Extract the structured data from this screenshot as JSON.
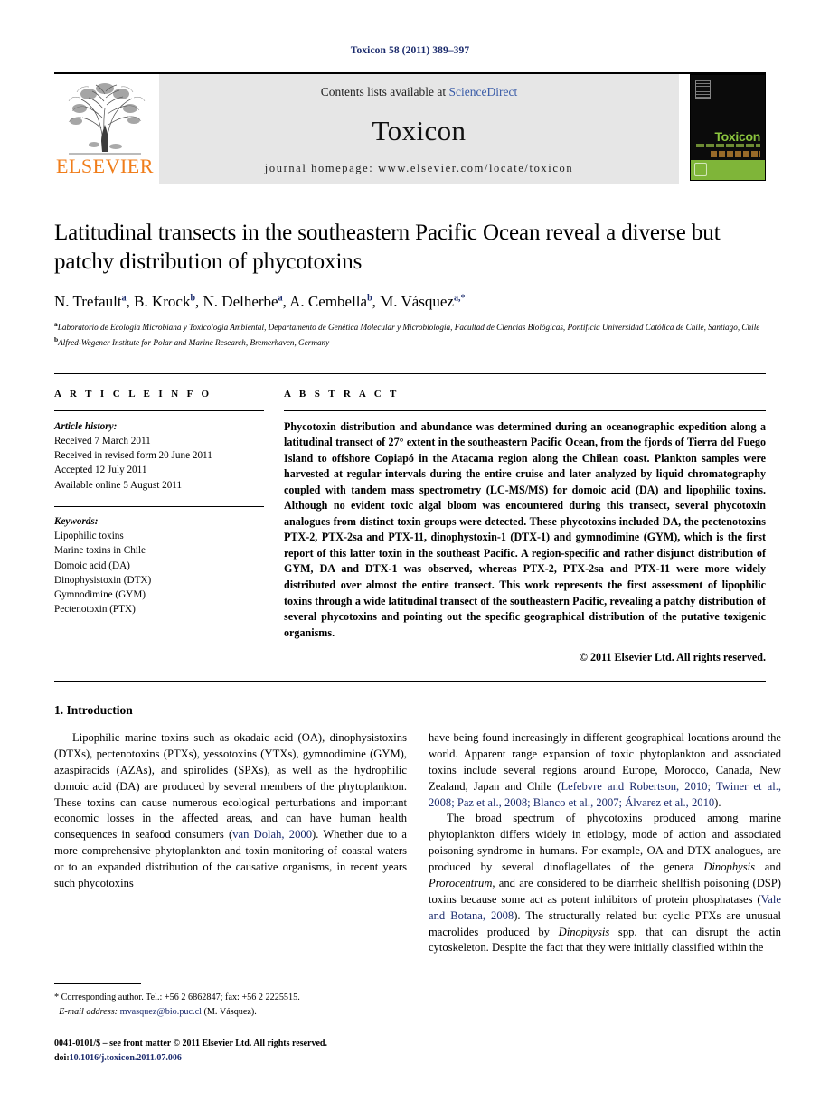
{
  "running_head": "Toxicon 58 (2011) 389–397",
  "masthead": {
    "publisher": "ELSEVIER",
    "contents_prefix": "Contents lists available at ",
    "sciencedirect": "ScienceDirect",
    "journal_title": "Toxicon",
    "homepage": "journal homepage: www.elsevier.com/locate/toxicon",
    "cover_title": "Toxicon",
    "accent_green": "#8cc63e",
    "elsevier_orange": "#f07d1a",
    "link_blue": "#1a2a6c"
  },
  "article": {
    "title": "Latitudinal transects in the southeastern Pacific Ocean reveal a diverse but patchy distribution of phycotoxins",
    "authors": [
      {
        "name": "N. Trefault",
        "marks": "a"
      },
      {
        "name": "B. Krock",
        "marks": "b"
      },
      {
        "name": "N. Delherbe",
        "marks": "a"
      },
      {
        "name": "A. Cembella",
        "marks": "b"
      },
      {
        "name": "M. Vásquez",
        "marks": "a,*"
      }
    ],
    "affiliations": [
      {
        "mark": "a",
        "text": "Laboratorio de Ecología Microbiana y Toxicología Ambiental, Departamento de Genética Molecular y Microbiología, Facultad de Ciencias Biológicas, Pontificia Universidad Católica de Chile, Santiago, Chile"
      },
      {
        "mark": "b",
        "text": "Alfred-Wegener Institute for Polar and Marine Research, Bremerhaven, Germany"
      }
    ]
  },
  "article_info": {
    "heading": "A R T I C L E   I N F O",
    "history_label": "Article history:",
    "history": [
      "Received 7 March 2011",
      "Received in revised form 20 June 2011",
      "Accepted 12 July 2011",
      "Available online 5 August 2011"
    ],
    "keywords_label": "Keywords:",
    "keywords": [
      "Lipophilic toxins",
      "Marine toxins in Chile",
      "Domoic acid (DA)",
      "Dinophysistoxin (DTX)",
      "Gymnodimine (GYM)",
      "Pectenotoxin (PTX)"
    ]
  },
  "abstract": {
    "heading": "A B S T R A C T",
    "text": "Phycotoxin distribution and abundance was determined during an oceanographic expedition along a latitudinal transect of 27° extent in the southeastern Pacific Ocean, from the fjords of Tierra del Fuego Island to offshore Copiapó in the Atacama region along the Chilean coast. Plankton samples were harvested at regular intervals during the entire cruise and later analyzed by liquid chromatography coupled with tandem mass spectrometry (LC-MS/MS) for domoic acid (DA) and lipophilic toxins. Although no evident toxic algal bloom was encountered during this transect, several phycotoxin analogues from distinct toxin groups were detected. These phycotoxins included DA, the pectenotoxins PTX-2, PTX-2sa and PTX-11, dinophystoxin-1 (DTX-1) and gymnodimine (GYM), which is the first report of this latter toxin in the southeast Pacific. A region-specific and rather disjunct distribution of GYM, DA and DTX-1 was observed, whereas PTX-2, PTX-2sa and PTX-11 were more widely distributed over almost the entire transect. This work represents the first assessment of lipophilic toxins through a wide latitudinal transect of the southeastern Pacific, revealing a patchy distribution of several phycotoxins and pointing out the specific geographical distribution of the putative toxigenic organisms.",
    "copyright": "© 2011 Elsevier Ltd. All rights reserved."
  },
  "section": {
    "heading": "1. Introduction"
  },
  "body": {
    "left_p1_a": "Lipophilic marine toxins such as okadaic acid (OA), dinophysistoxins (DTXs), pectenotoxins (PTXs), yessotoxins (YTXs), gymnodimine (GYM), azaspiracids (AZAs), and spirolides (SPXs), as well as the hydrophilic domoic acid (DA) are produced by several members of the phytoplankton. These toxins can cause numerous ecological perturbations and important economic losses in the affected areas, and can have human health consequences in seafood consumers (",
    "left_cite1": "van Dolah, 2000",
    "left_p1_b": "). Whether due to a more comprehensive phytoplankton and toxin monitoring of coastal waters or to an expanded distribution of the causative organisms, in recent years such phycotoxins",
    "right_p1_a": "have being found increasingly in different geographical locations around the world. Apparent range expansion of toxic phytoplankton and associated toxins include several regions around Europe, Morocco, Canada, New Zealand, Japan and Chile (",
    "right_cite1": "Lefebvre and Robertson, 2010; Twiner et al., 2008; Paz et al., 2008; Blanco et al., 2007; Álvarez et al., 2010",
    "right_p1_b": ").",
    "right_p2_a": "The broad spectrum of phycotoxins produced among marine phytoplankton differs widely in etiology, mode of action and associated poisoning syndrome in humans. For example, OA and DTX analogues, are produced by several dinoflagellates of the genera ",
    "right_genus1": "Dinophysis",
    "right_p2_b": " and ",
    "right_genus2": "Prorocentrum",
    "right_p2_c": ", and are considered to be diarrheic shellfish poisoning (DSP) toxins because some act as potent inhibitors of protein phosphatases (",
    "right_cite2": "Vale and Botana, 2008",
    "right_p2_d": "). The structurally related but cyclic PTXs are unusual macrolides produced by ",
    "right_genus3": "Dinophysis",
    "right_p2_e": " spp. that can disrupt the actin cytoskeleton. Despite the fact that they were initially classified within the"
  },
  "footnotes": {
    "corresponding": "* Corresponding author. Tel.: +56 2 6862847; fax: +56 2 2225515.",
    "email_label": "E-mail address:",
    "email": "mvasquez@bio.puc.cl",
    "email_suffix": "(M. Vásquez).",
    "imprint": "0041-0101/$ – see front matter © 2011 Elsevier Ltd. All rights reserved.",
    "doi_label": "doi:",
    "doi": "10.1016/j.toxicon.2011.07.006"
  }
}
